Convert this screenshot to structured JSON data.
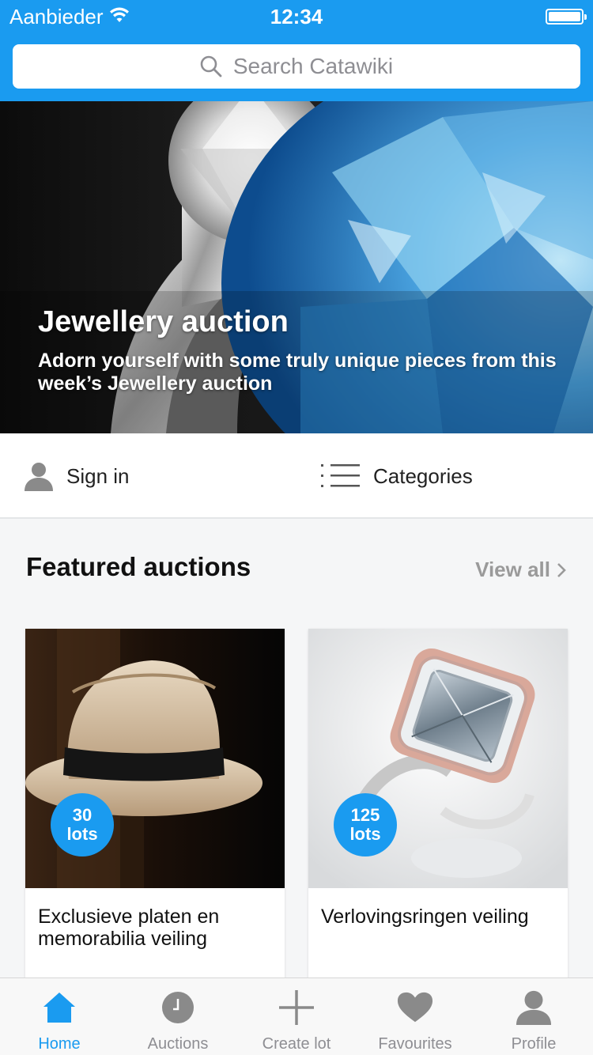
{
  "status_bar": {
    "carrier": "Aanbieder",
    "time": "12:34"
  },
  "search": {
    "placeholder": "Search Catawiki"
  },
  "hero": {
    "title": "Jewellery auction",
    "subtitle": "Adorn yourself with some truly unique pieces from this week’s Jewellery auction"
  },
  "actions": {
    "sign_in": "Sign in",
    "categories": "Categories"
  },
  "featured": {
    "title": "Featured auctions",
    "view_all": "View all",
    "cards": [
      {
        "count": "30",
        "unit": "lots",
        "name": "Exclusieve platen en memorabilia veiling"
      },
      {
        "count": "125",
        "unit": "lots",
        "name": "Verlovingsringen veiling"
      }
    ]
  },
  "tabbar": {
    "items": [
      {
        "label": "Home",
        "icon": "home-icon",
        "active": true
      },
      {
        "label": "Auctions",
        "icon": "clock-icon"
      },
      {
        "label": "Create lot",
        "icon": "plus-icon"
      },
      {
        "label": "Favourites",
        "icon": "heart-icon"
      },
      {
        "label": "Profile",
        "icon": "person-icon"
      }
    ]
  },
  "colors": {
    "accent": "#1a9bf0",
    "inactive": "#8e8e93"
  }
}
